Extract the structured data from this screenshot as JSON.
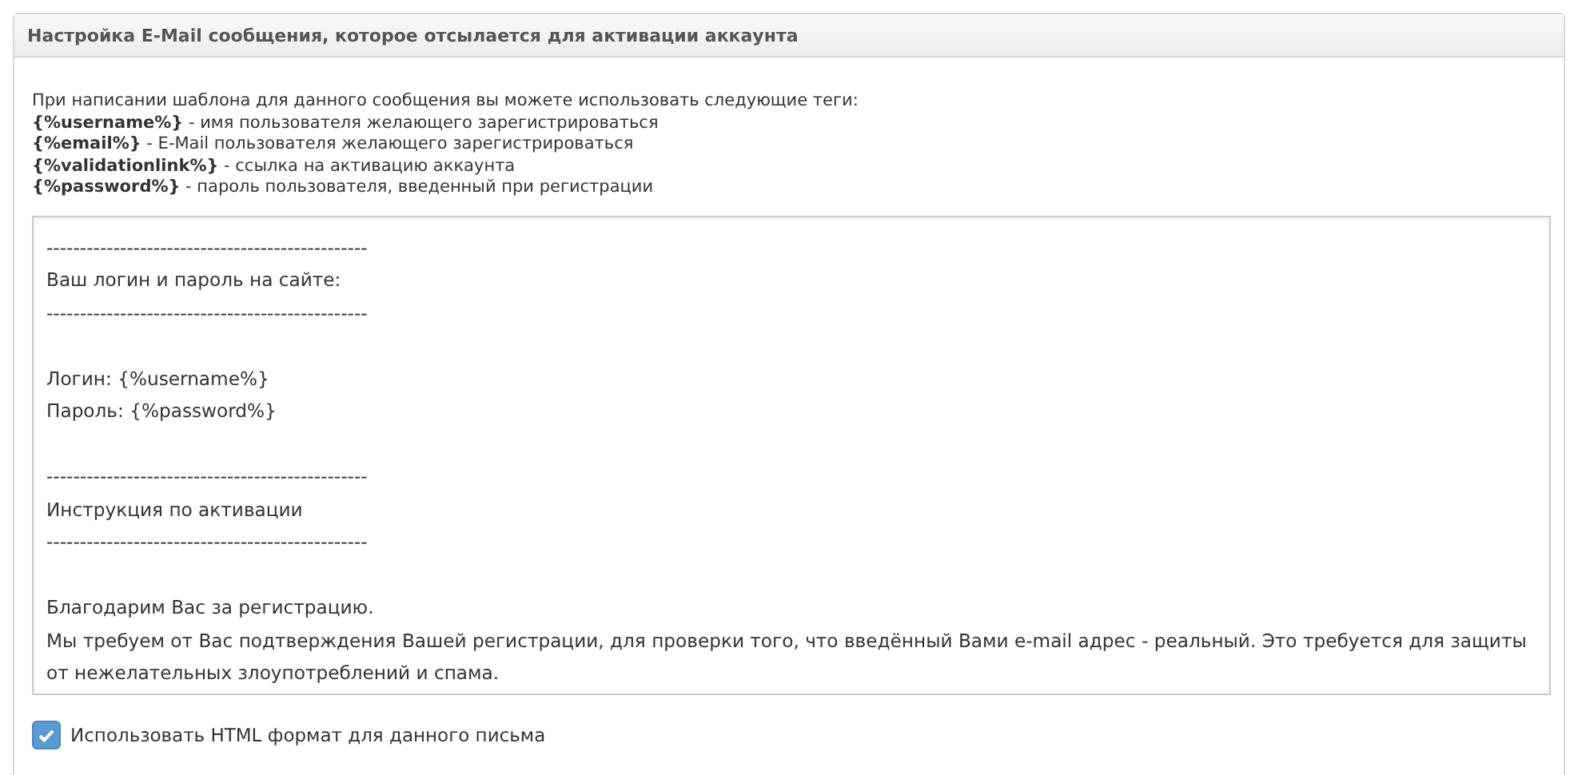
{
  "panel": {
    "title": "Настройка E-Mail сообщения, которое отсылается для активации аккаунта"
  },
  "intro": "При написании шаблона для данного сообщения вы можете использовать следующие теги:",
  "tags": [
    {
      "tag": "{%username%}",
      "description": " - имя пользователя желающего зарегистрироваться"
    },
    {
      "tag": "{%email%}",
      "description": " - E-Mail пользователя желающего зарегистрироваться"
    },
    {
      "tag": "{%validationlink%}",
      "description": " - ссылка на активацию аккаунта"
    },
    {
      "tag": "{%password%}",
      "description": " - пароль пользователя, введенный при регистрации"
    }
  ],
  "message": {
    "value": "------------------------------------------------\nВаш логин и пароль на сайте:\n------------------------------------------------\n\nЛогин: {%username%}\nПароль: {%password%}\n\n------------------------------------------------\nИнструкция по активации\n------------------------------------------------\n\nБлагодарим Вас за регистрацию.\nМы требуем от Вас подтверждения Вашей регистрации, для проверки того, что введённый Вами e-mail адрес - реальный. Это требуется для защиты от нежелательных злоупотреблений и спама."
  },
  "html_format": {
    "label": "Использовать HTML формат для данного письма",
    "checked": true
  }
}
